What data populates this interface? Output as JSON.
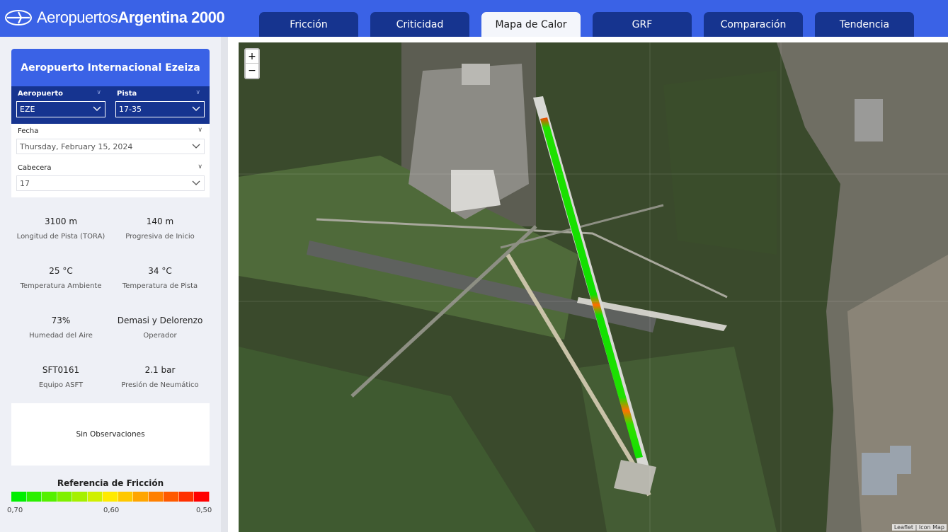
{
  "header": {
    "brand_light": "Aeropuertos",
    "brand_bold": "Argentina 2000",
    "tabs": [
      {
        "label": "Fricción",
        "active": false
      },
      {
        "label": "Criticidad",
        "active": false
      },
      {
        "label": "Mapa de Calor",
        "active": true
      },
      {
        "label": "GRF",
        "active": false
      },
      {
        "label": "Comparación",
        "active": false
      },
      {
        "label": "Tendencia",
        "active": false
      }
    ]
  },
  "sidebar": {
    "airport_title": "Aeropuerto Internacional Ezeiza",
    "aeropuerto": {
      "label": "Aeropuerto",
      "value": "EZE"
    },
    "pista": {
      "label": "Pista",
      "value": "17-35"
    },
    "fecha": {
      "label": "Fecha",
      "value": "Thursday, February 15, 2024"
    },
    "cabecera": {
      "label": "Cabecera",
      "value": "17"
    },
    "stats": [
      {
        "value": "3100 m",
        "label": "Longitud de Pista (TORA)"
      },
      {
        "value": "140 m",
        "label": "Progresiva de Inicio"
      },
      {
        "value": "25 °C",
        "label": "Temperatura Ambiente"
      },
      {
        "value": "34 °C",
        "label": "Temperatura de Pista"
      },
      {
        "value": "73%",
        "label": "Humedad del Aire"
      },
      {
        "value": "Demasi y Delorenzo",
        "label": "Operador"
      },
      {
        "value": "SFT0161",
        "label": "Equipo ASFT"
      },
      {
        "value": "2.1 bar",
        "label": "Presión de Neumático"
      }
    ],
    "observations": "Sin Observaciones",
    "legend": {
      "title": "Referencia de Fricción",
      "ticks": [
        "0,70",
        "0,60",
        "0,50"
      ],
      "colors": [
        "#00ee00",
        "#2bef00",
        "#55f000",
        "#7ff000",
        "#a5f000",
        "#d0f000",
        "#ffea00",
        "#ffc800",
        "#ffa500",
        "#ff8000",
        "#ff5a00",
        "#ff3000",
        "#ff0000"
      ]
    }
  },
  "map": {
    "zoom_in": "+",
    "zoom_out": "−",
    "attribution": "Leaflet | Icon Map"
  }
}
